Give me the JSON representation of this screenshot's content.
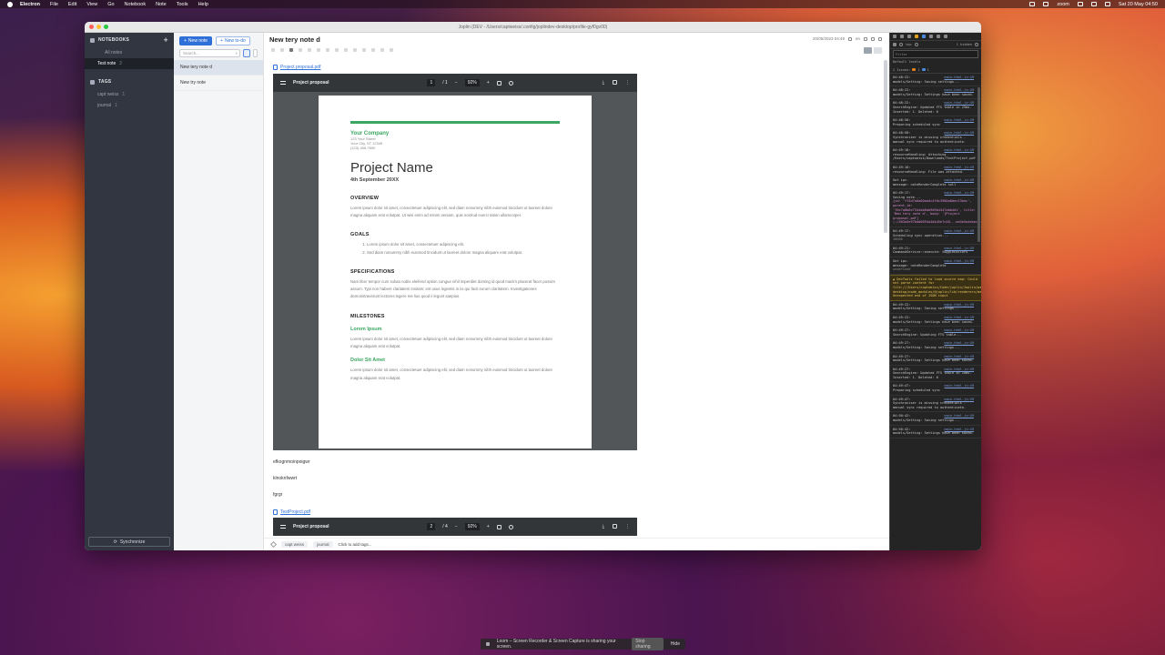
{
  "menubar": {
    "app": "Electron",
    "items": [
      "File",
      "Edit",
      "View",
      "Go",
      "Notebook",
      "Note",
      "Tools",
      "Help"
    ],
    "zoom": "zoom",
    "datetime": "Sat 20 May  04:50"
  },
  "window": {
    "title": "Joplin (DEV - /Users/captweiss/.config/joplindev-desktop/profile-gyf0gv00)"
  },
  "sidebar": {
    "notebooks_header": "NOTEBOOKS",
    "add_label": "+",
    "all_notes": "All notes",
    "notebooks": [
      {
        "label": "Test note",
        "count": "2"
      }
    ],
    "tags_header": "TAGS",
    "tags": [
      {
        "label": "capt weiss",
        "count": "1"
      },
      {
        "label": "journal",
        "count": "1"
      }
    ],
    "sync_label": "Synchronize"
  },
  "notelist": {
    "new_note": "New note",
    "new_todo": "New to-do",
    "search_placeholder": "Search...",
    "notes": [
      "New tery note d",
      "New try note"
    ]
  },
  "editor": {
    "title": "New tery note d",
    "datetime": "20/05/2023 04:49",
    "lang": "en",
    "attachment1": "Project proposal.pdf",
    "attachment2": "TestProject.pdf",
    "lines": [
      "efkognmoinpoigwr",
      "klnoknfwwrt",
      "fgrgr"
    ],
    "tags": [
      "capt weiss",
      "journal"
    ],
    "add_tags": "Click to add tags..."
  },
  "pdf1": {
    "title": "Project proposal",
    "page": "1",
    "pages": "/ 1",
    "zoom": "92%",
    "company": "Your Company",
    "address": [
      "123 Your Street",
      "Your City, ST 12345",
      "(123) 456-7890"
    ],
    "project_name": "Project Name",
    "date": "4th September 20XX",
    "overview_h": "OVERVIEW",
    "overview_p": "Lorem ipsum dolor sit amet, consectetuer adipiscing elit, sed diam nonummy nibh euismod tincidunt ut laoreet dolore magna aliquam erat volutpat. Ut wisi enim ad minim veniam, quis nostrud exerci tation ullamcorper.",
    "goals_h": "GOALS",
    "goals": [
      "Lorem ipsum dolor sit amet, consectetuer adipiscing elit.",
      "Sed diam nonummy nibh euismod tincidunt ut laoreet dolore magna aliquam erat volutpat."
    ],
    "spec_h": "SPECIFICATIONS",
    "spec_p": "Nam liber tempor cum soluta nobis eleifend option congue nihil imperdiet doming id quod mazim placerat facer possim assum. Typi non habent claritatem insitam; est usus legentis in iis qui facit eorum claritatem. Investigationes demonstraverunt lectores legere me lius quod ii legunt saepius.",
    "milestones_h": "MILESTONES",
    "m1_h": "Lorem Ipsum",
    "m1_p": "Lorem ipsum dolor sit amet, consectetuer adipiscing elit, sed diam nonummy nibh euismod tincidunt ut laoreet dolore magna aliquam erat volutpat.",
    "m2_h": "Dolor Sit Amet",
    "m2_p": "Lorem ipsum dolor sit amet, consectetuer adipiscing elit, sed diam nonummy nibh euismod tincidunt ut laoreet dolore magna aliquam erat volutpat."
  },
  "pdf2": {
    "title": "Project proposal",
    "page": "2",
    "pages": "/ 4",
    "zoom": "92%"
  },
  "devtools": {
    "top_label": "top",
    "hidden": "1 hidden",
    "filter_placeholder": "Filter",
    "levels": "Default levels",
    "issues": "2 Issues:",
    "issues_warn": "1",
    "issues_info": "1",
    "logs": [
      {
        "t": "04:48:22:",
        "src": "main-html.js:49",
        "msg": "models/Setting: Saving settings..."
      },
      {
        "t": "04:48:22:",
        "src": "main-html.js:49",
        "msg": "models/Setting: Settings have been saved."
      },
      {
        "t": "04:48:22:",
        "src": "main-html.js:49",
        "msg": "SearchEngine: Updated FTS table in 25ms. Inserted: 1. Deleted: 0"
      },
      {
        "t": "04:48:50:",
        "src": "main-html.js:49",
        "msg": "Preparing scheduled sync"
      },
      {
        "t": "04:48:50:",
        "src": "main-html.js:49",
        "msg": "Synchroniser is missing credentials - manual sync required to authenticate."
      },
      {
        "t": "04:49:16:",
        "src": "main-html.js:49",
        "msg": "resourceHandling: Attaching /Users/captweiss/Downloads/TestProject.pdf"
      },
      {
        "t": "04:49:16:",
        "src": "main-html.js:49",
        "msg": "resourceHandling: File was attached."
      },
      {
        "t": "Got ipc-",
        "src": "main-html.js:49",
        "msg": "message: noteRenderComplete null"
      },
      {
        "t": "04:49:17:",
        "src": "main-html.js:49",
        "msg": "Saving note...",
        "obj": "{id: 'ff3d7a0a00ad4c4f8c3980a8dec23eec', parent_id: 'f0c7a8b6e7344ab8ab9d9b4447abb4d1', title: 'New tery note d', body: '[Project proposal.pdf](:/403a5e976dd0694a4d4d5e7c48...ed4e5a4ebec...'}"
      },
      {
        "t": "04:49:17:",
        "src": "main-html.js:49",
        "msg": "Scheduling sync operation...",
        "und": "30000"
      },
      {
        "t": "04:49:21:",
        "src": "main-html.js:49",
        "msg": "CommandService::execute: toggleEditors"
      },
      {
        "t": "Got ipc-",
        "src": "main-html.js:49",
        "msg": "message: noteRenderComplete",
        "und": "undefined"
      }
    ],
    "warning": "DevTools failed to load source map: Could not parse content for file:///Users/captweiss/Code/joplin/Joplin/packages/app-desktop/node_modules/@joplin/lib/renderers/mermaid/mermaid.min.js.map: Unexpected end of JSON input",
    "logs2": [
      {
        "t": "04:49:22:",
        "src": "main-html.js:49",
        "msg": "models/Setting: Saving settings..."
      },
      {
        "t": "04:49:22:",
        "src": "main-html.js:49",
        "msg": "models/Setting: Settings have been saved."
      },
      {
        "t": "04:49:27:",
        "src": "main-html.js:49",
        "msg": "SearchEngine: Updating FTS table..."
      },
      {
        "t": "04:49:27:",
        "src": "main-html.js:49",
        "msg": "models/Setting: Saving settings..."
      },
      {
        "t": "04:49:27:",
        "src": "main-html.js:49",
        "msg": "models/Setting: Settings have been saved."
      },
      {
        "t": "04:49:27:",
        "src": "main-html.js:49",
        "msg": "SearchEngine: Updated FTS table in 10ms. Inserted: 1. Deleted: 0"
      },
      {
        "t": "04:49:47:",
        "src": "main-html.js:49",
        "msg": "Preparing scheduled sync"
      },
      {
        "t": "04:49:47:",
        "src": "main-html.js:49",
        "msg": "Synchroniser is missing credentials - manual sync required to authenticate."
      },
      {
        "t": "04:50:42:",
        "src": "main-html.js:49",
        "msg": "models/Setting: Saving settings..."
      },
      {
        "t": "04:50:42:",
        "src": "main-html.js:49",
        "msg": "models/Setting: Settings have been saved."
      }
    ]
  },
  "loom": {
    "message": "Loom – Screen Recorder & Screen Capture is sharing your screen.",
    "stop": "Stop sharing",
    "hide": "Hide"
  }
}
